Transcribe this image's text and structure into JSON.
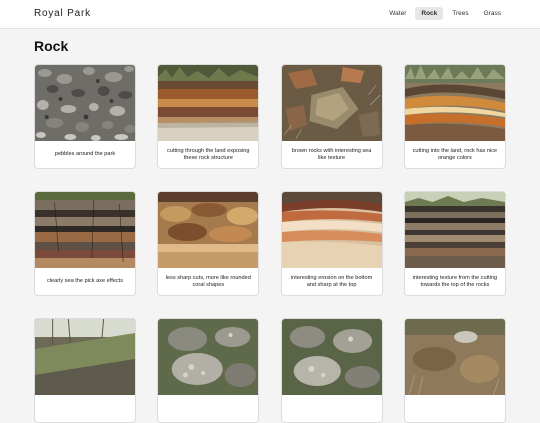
{
  "header": {
    "brand": "Royal Park",
    "nav": [
      {
        "label": "Water",
        "active": false
      },
      {
        "label": "Rock",
        "active": true
      },
      {
        "label": "Trees",
        "active": false
      },
      {
        "label": "Grass",
        "active": false
      }
    ]
  },
  "page": {
    "title": "Rock"
  },
  "gallery": [
    {
      "caption": "pebbles around the park",
      "image": "grey-pebbles-photo"
    },
    {
      "caption": "cutting through the land exposing these rock structure",
      "image": "layered-cutting-photo"
    },
    {
      "caption": "brown rocks with interesting sea like texture",
      "image": "brown-rocks-photo"
    },
    {
      "caption": "cutting into the land, rock has nice orange colors",
      "image": "orange-rock-photo"
    },
    {
      "caption": "clearly sea the pick axe effects",
      "image": "dark-layered-cliff-photo"
    },
    {
      "caption": "less sharp cuts, more like rounded coral shapes",
      "image": "ochre-rounded-rock-photo"
    },
    {
      "caption": "interesting erosion on the bottom and sharp at the top",
      "image": "sandstone-erosion-photo"
    },
    {
      "caption": "interesting texture from the cutting towards the top of the rocks",
      "image": "stratified-outcrop-photo"
    },
    {
      "caption": "",
      "image": "grassy-slope-photo"
    },
    {
      "caption": "",
      "image": "lichen-boulder-photo"
    },
    {
      "caption": "",
      "image": "lichen-boulder-photo-2"
    },
    {
      "caption": "",
      "image": "dry-scrub-rock-photo"
    }
  ]
}
